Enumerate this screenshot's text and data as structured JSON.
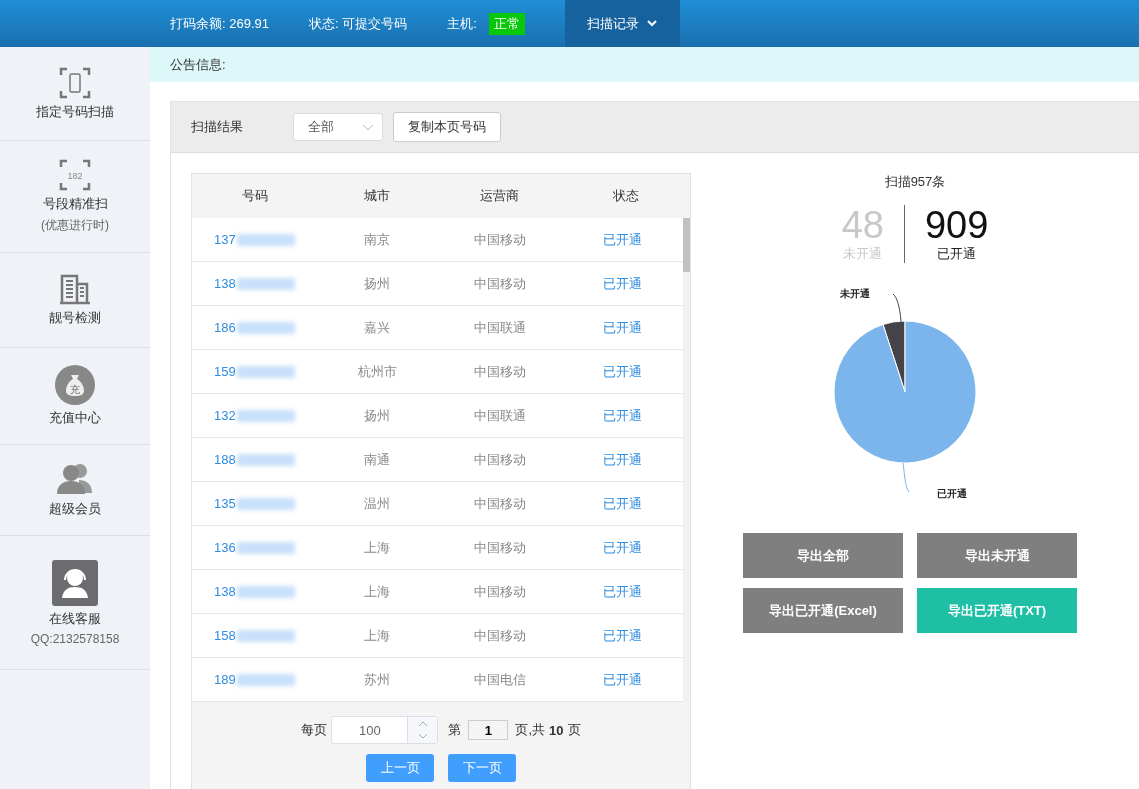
{
  "topbar": {
    "balance_label": "打码余额:",
    "balance": "269.91",
    "status_label": "状态:",
    "status": "可提交号码",
    "host_label": "主机:",
    "host_status": "正常",
    "menu": "扫描记录"
  },
  "sidebar": {
    "items": [
      {
        "kind": "phone",
        "label": "指定号码扫描",
        "selected": false
      },
      {
        "kind": "segment",
        "icon_text": "182",
        "label": "号段精准扫",
        "sublabel": "(优惠进行时)",
        "selected": false
      },
      {
        "kind": "building",
        "label": "靓号检测",
        "selected": false
      },
      {
        "kind": "bag",
        "icon_text": "充",
        "label": "充值中心",
        "selected": false
      },
      {
        "kind": "users",
        "label": "超级会员",
        "selected": false
      },
      {
        "kind": "support",
        "label": "在线客服",
        "sublabel": "QQ:2132578158",
        "selected": false
      }
    ]
  },
  "notice": {
    "label": "公告信息:"
  },
  "results": {
    "title": "扫描结果",
    "filter": "全部",
    "copy_button": "复制本页号码"
  },
  "table": {
    "columns": [
      "号码",
      "城市",
      "运营商",
      "状态"
    ],
    "rows": [
      {
        "number": "137",
        "city": "南京",
        "carrier": "中国移动",
        "status": "已开通"
      },
      {
        "number": "138",
        "city": "扬州",
        "carrier": "中国移动",
        "status": "已开通"
      },
      {
        "number": "186",
        "city": "嘉兴",
        "carrier": "中国联通",
        "status": "已开通"
      },
      {
        "number": "159",
        "city": "杭州市",
        "carrier": "中国移动",
        "status": "已开通"
      },
      {
        "number": "132",
        "city": "扬州",
        "carrier": "中国联通",
        "status": "已开通"
      },
      {
        "number": "188",
        "city": "南通",
        "carrier": "中国移动",
        "status": "已开通"
      },
      {
        "number": "135",
        "city": "温州",
        "carrier": "中国移动",
        "status": "已开通"
      },
      {
        "number": "136",
        "city": "上海",
        "carrier": "中国移动",
        "status": "已开通"
      },
      {
        "number": "138",
        "city": "上海",
        "carrier": "中国移动",
        "status": "已开通"
      },
      {
        "number": "158",
        "city": "上海",
        "carrier": "中国移动",
        "status": "已开通"
      },
      {
        "number": "189",
        "city": "苏州",
        "carrier": "中国电信",
        "status": "已开通"
      }
    ]
  },
  "pagination": {
    "per_page_label": "每页",
    "per_page": "100",
    "page_prefix": "第",
    "page": "1",
    "page_suffix": "页,共",
    "total_pages": "10",
    "pages_unit": "页",
    "prev": "上一页",
    "next": "下一页"
  },
  "summary": {
    "title": "扫描957条",
    "inactive_count": "48",
    "inactive_label": "未开通",
    "active_count": "909",
    "active_label": "已开通"
  },
  "chart_data": {
    "type": "pie",
    "categories": [
      "未开通",
      "已开通"
    ],
    "series": [
      {
        "colors": [
          "#434348",
          "#7cb5ec"
        ],
        "values": [
          48,
          909
        ]
      }
    ],
    "data_labels": true
  },
  "export_buttons": [
    {
      "label": "导出全部",
      "kind": "grey"
    },
    {
      "label": "导出未开通",
      "kind": "grey"
    },
    {
      "label": "导出已开通(Excel)",
      "kind": "grey"
    },
    {
      "label": "导出已开通(TXT)",
      "kind": "accent"
    }
  ]
}
